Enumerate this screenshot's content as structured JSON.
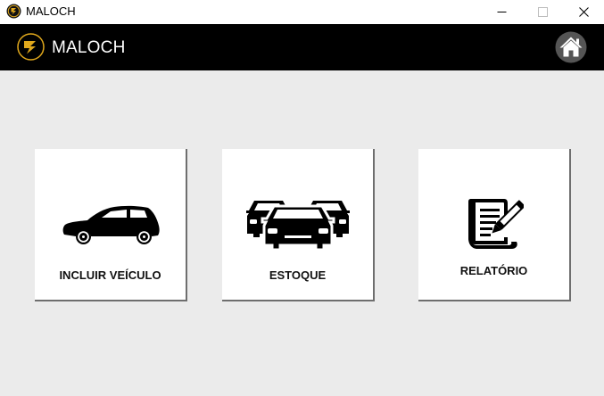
{
  "window": {
    "title": "MALOCH",
    "controls": {
      "minimize": "minimize-icon",
      "maximize": "maximize-icon",
      "close": "close-icon"
    }
  },
  "header": {
    "app_name": "MALOCH",
    "logo_icon": "maloch-logo-icon",
    "home_icon": "home-icon"
  },
  "cards": [
    {
      "label": "INCLUIR VEÍCULO",
      "icon": "car-icon"
    },
    {
      "label": "ESTOQUE",
      "icon": "cars-icon"
    },
    {
      "label": "RELATÓRIO",
      "icon": "report-icon"
    }
  ],
  "colors": {
    "header_bg": "#000000",
    "main_bg": "#ebebeb",
    "card_bg": "#ffffff",
    "logo_accent": "#e0a81c"
  }
}
